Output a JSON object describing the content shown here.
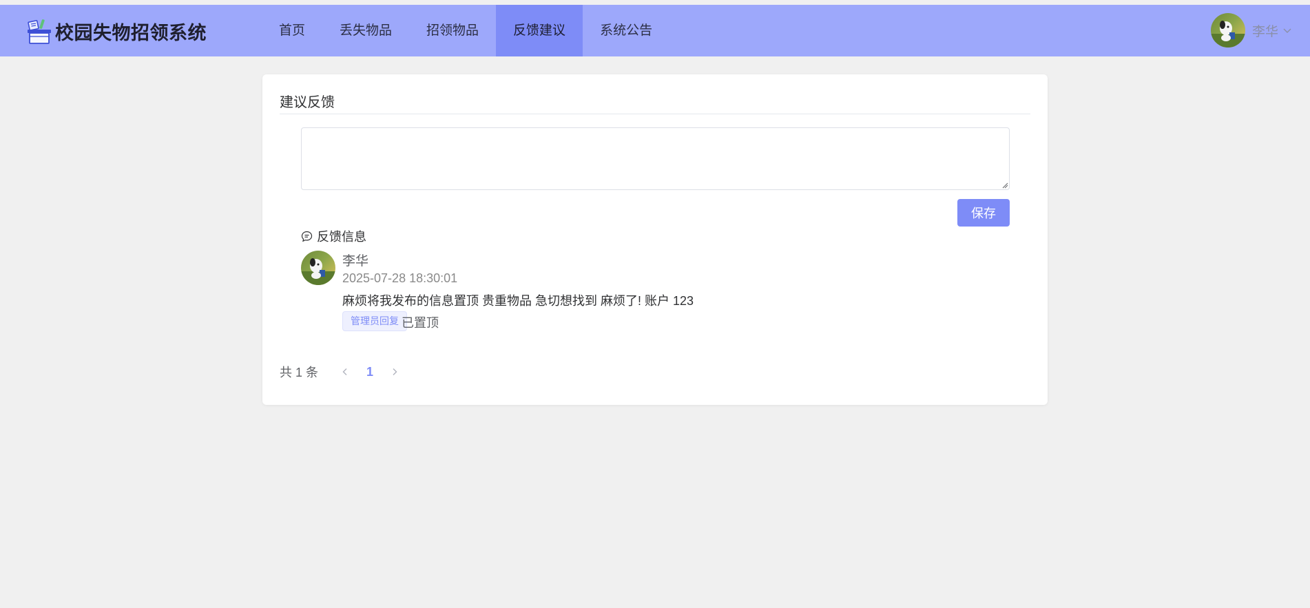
{
  "header": {
    "title": "校园失物招领系统",
    "nav": [
      {
        "label": "首页",
        "active": false
      },
      {
        "label": "丢失物品",
        "active": false
      },
      {
        "label": "招领物品",
        "active": false
      },
      {
        "label": "反馈建议",
        "active": true
      },
      {
        "label": "系统公告",
        "active": false
      }
    ],
    "user": {
      "name": "李华",
      "avatar": "user-avatar",
      "menu_icon": "chevron-down-icon"
    }
  },
  "feedback_form": {
    "title": "建议反馈",
    "textarea_value": "",
    "textarea_placeholder": "",
    "save_label": "保存"
  },
  "feedback_list": {
    "section_label": "反馈信息",
    "section_icon": "chat-bubble-icon",
    "items": [
      {
        "author": "李华",
        "time": "2025-07-28 18:30:01",
        "content": "麻烦将我发布的信息置顶 贵重物品 急切想找到 麻烦了!  账户 123",
        "tag": "管理员回复",
        "reply": "已置顶"
      }
    ]
  },
  "pagination": {
    "total_text": "共 1 条",
    "current_page": "1",
    "prev_icon": "chevron-left-icon",
    "next_icon": "chevron-right-icon"
  },
  "colors": {
    "header_bg": "#9da8fb",
    "nav_active_bg": "#7e8cf7",
    "accent": "#7e8cf7",
    "page_bg": "#f0f0f0"
  }
}
